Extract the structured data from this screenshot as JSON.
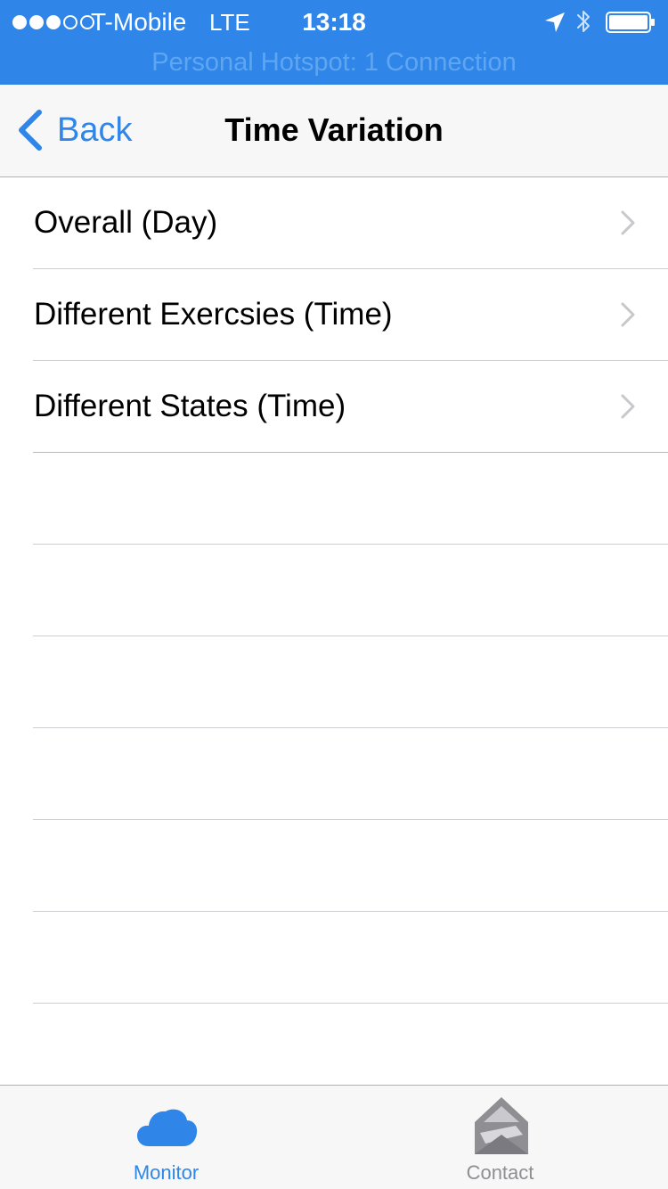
{
  "status_bar": {
    "carrier": "T-Mobile",
    "network": "LTE",
    "time": "13:18",
    "signal_strength": 3,
    "signal_max": 5,
    "hotspot_text": "Personal Hotspot: 1 Connection",
    "background_color": "#2f86e8",
    "icons": [
      "location-arrow-icon",
      "bluetooth-icon",
      "battery-icon"
    ]
  },
  "nav_bar": {
    "back_label": "Back",
    "title": "Time Variation",
    "accent_color": "#2f86e8"
  },
  "table": {
    "rows": [
      {
        "label": "Overall (Day)"
      },
      {
        "label": "Different Exercsies (Time)"
      },
      {
        "label": "Different States (Time)"
      }
    ]
  },
  "tab_bar": {
    "tabs": [
      {
        "label": "Monitor",
        "icon": "cloud-icon",
        "selected": true
      },
      {
        "label": "Contact",
        "icon": "envelope-icon",
        "selected": false
      }
    ],
    "selected_color": "#2f86e8",
    "unselected_color": "#8e8e93"
  }
}
